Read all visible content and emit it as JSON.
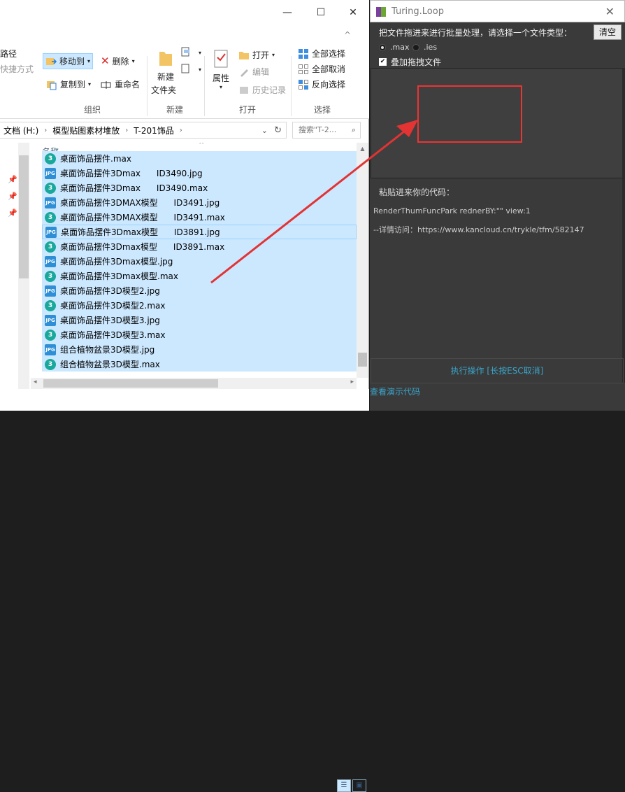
{
  "explorer": {
    "window_controls": [
      "—",
      "☐",
      "✕"
    ],
    "help_chevron": "^",
    "ribbon": {
      "path_label": "路径",
      "shortcut_label": "快捷方式",
      "move_to": "移动到",
      "copy_to": "复制到",
      "delete": "删除",
      "rename": "重命名",
      "new_folder_line1": "新建",
      "new_folder_line2": "文件夹",
      "properties": "属性",
      "open": "打开",
      "edit": "编辑",
      "history": "历史记录",
      "select_all": "全部选择",
      "select_none": "全部取消",
      "invert_select": "反向选择",
      "groups": [
        "组织",
        "新建",
        "打开",
        "选择"
      ]
    },
    "address": {
      "crumbs": [
        "文档 (H:)",
        "模型贴图素材堆放",
        "T-201饰品"
      ],
      "search_placeholder": "搜索\"T-2..."
    },
    "column_header": "名称",
    "files": [
      {
        "name": "桌面饰品摆件.max",
        "type": "max"
      },
      {
        "name": "桌面饰品摆件3Dmax      ID3490.jpg",
        "type": "jpg"
      },
      {
        "name": "桌面饰品摆件3Dmax      ID3490.max",
        "type": "max"
      },
      {
        "name": "桌面饰品摆件3DMAX模型      ID3491.jpg",
        "type": "jpg"
      },
      {
        "name": "桌面饰品摆件3DMAX模型      ID3491.max",
        "type": "max"
      },
      {
        "name": "桌面饰品摆件3Dmax模型      ID3891.jpg",
        "type": "jpg"
      },
      {
        "name": "桌面饰品摆件3Dmax模型      ID3891.max",
        "type": "max"
      },
      {
        "name": "桌面饰品摆件3Dmax模型.jpg",
        "type": "jpg"
      },
      {
        "name": "桌面饰品摆件3Dmax模型.max",
        "type": "max"
      },
      {
        "name": "桌面饰品摆件3D模型2.jpg",
        "type": "jpg"
      },
      {
        "name": "桌面饰品摆件3D模型2.max",
        "type": "max"
      },
      {
        "name": "桌面饰品摆件3D模型3.jpg",
        "type": "jpg"
      },
      {
        "name": "桌面饰品摆件3D模型3.max",
        "type": "max"
      },
      {
        "name": "组合植物盆景3D模型.jpg",
        "type": "jpg"
      },
      {
        "name": "组合植物盆景3D模型.max",
        "type": "max"
      }
    ],
    "file_icon_labels": {
      "jpg": "JPG",
      "max": "3"
    }
  },
  "app": {
    "title": "Turing.Loop",
    "close": "✕",
    "prompt": "把文件拖进来进行批量处理，请选择一个文件类型：",
    "clear_button": "清空",
    "option_max": ".max",
    "option_ies": ".ies",
    "overlay_checkbox": "叠加拖拽文件",
    "paste_label": "粘贴进来你的代码：",
    "code_line1": "RenderThumFuncPark rednerBY:\"\" view:1",
    "code_line2": "--详情访问：https://www.kancloud.cn/trykle/tfm/582147",
    "execute_button": "执行操作 [长按ESC取消]",
    "demo_link": "查看演示代码"
  },
  "colors": {
    "selection": "#cce8ff",
    "app_bg": "#3a3a3a",
    "link": "#3aa3c8",
    "annotation_red": "#e33333"
  }
}
